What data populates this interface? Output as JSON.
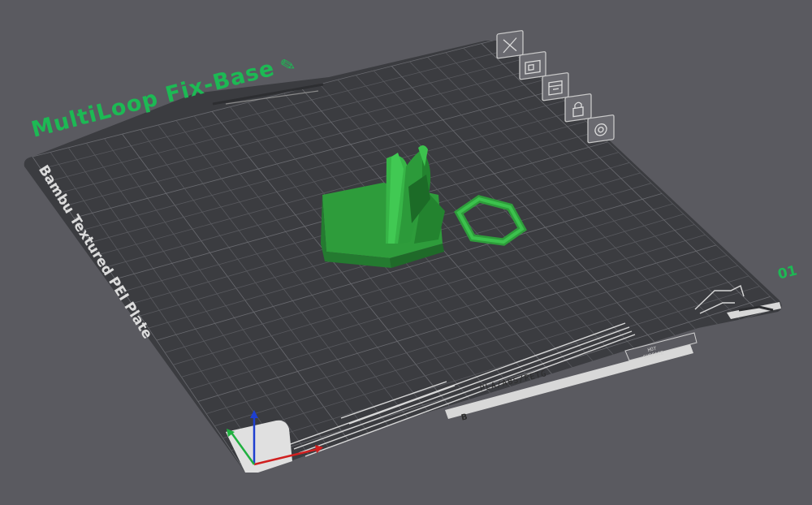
{
  "plate": {
    "name": "MultiLoop Fix-Base",
    "edit_icon": "pencil-icon",
    "type": "Bambu Textured PEI Plate",
    "index": "01"
  },
  "plate_toolbar": [
    {
      "id": "delete",
      "icon": "close-icon"
    },
    {
      "id": "arrange",
      "icon": "arrange-icon"
    },
    {
      "id": "orient",
      "icon": "orient-icon"
    },
    {
      "id": "lock",
      "icon": "lock-icon"
    },
    {
      "id": "settings",
      "icon": "gear-icon"
    }
  ],
  "bed_marks": {
    "filament_types": "PLA/ABS/PETG",
    "bed_logo": "B",
    "surface_notice": [
      "HOT",
      "SURFACE"
    ]
  },
  "colors": {
    "background": "#5a5a60",
    "bed": "#3b3c40",
    "grid": "#58595e",
    "model": "#29a83a",
    "accent": "#1db954"
  }
}
